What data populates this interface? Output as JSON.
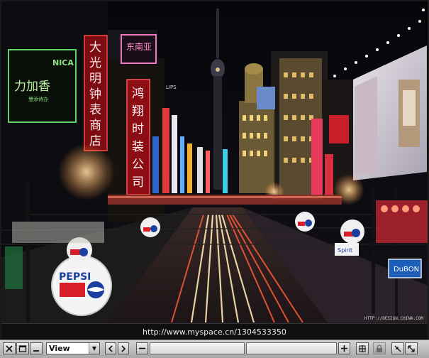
{
  "photo": {
    "description_alt": "Night street scene with neon signs",
    "signs": {
      "nica_brand": "NICA",
      "nica_sub": "力加香",
      "nica_small": "慧添诗办",
      "vertical_red_1": [
        "大",
        "光",
        "明",
        "钟",
        "表",
        "商",
        "店"
      ],
      "vertical_red_2": [
        "鸿",
        "翔",
        "时",
        "装",
        "公",
        "司"
      ],
      "top_sign": "东南亚",
      "pepsi": "PEPSI",
      "dubon": "DuBON",
      "shop_sign": "Spirit",
      "lips_sign": "LIPS"
    },
    "credit": "HTTP://DESIGN.CHINA.COM"
  },
  "status": {
    "url": "http://www.myspace.cn/1304533350"
  },
  "toolbar": {
    "view_label": "View"
  }
}
